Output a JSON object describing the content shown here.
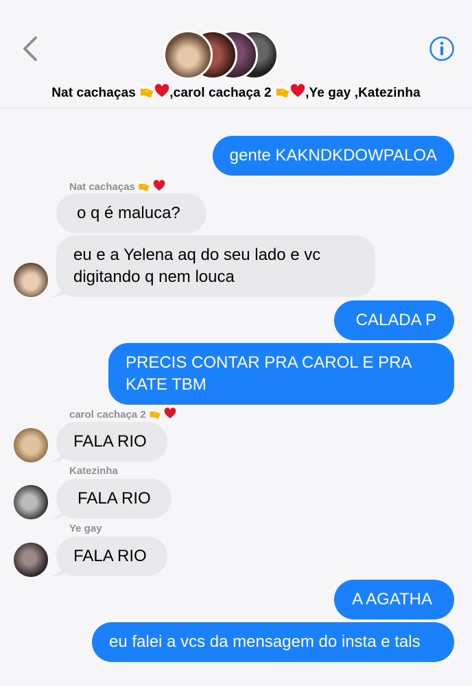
{
  "header": {
    "back_icon": "chevron-left-icon",
    "info_icon": "info-circle-icon",
    "group_name_parts": [
      "Nat cachaças",
      ",carol cachaça 2",
      ",Ye gay",
      ",Katezinha"
    ],
    "accent_color": "#1b81fb"
  },
  "messages": [
    {
      "id": "m1",
      "direction": "outgoing",
      "text": "gente KAKNDKDOWPALOA"
    },
    {
      "id": "m2",
      "direction": "incoming",
      "sender": "Nat cachaças",
      "text": "o q é maluca?"
    },
    {
      "id": "m3",
      "direction": "incoming",
      "sender": "Nat cachaças",
      "text": "eu e a Yelena aq do seu lado e vc digitando q nem louca"
    },
    {
      "id": "m4",
      "direction": "outgoing",
      "text": "CALADA P"
    },
    {
      "id": "m5",
      "direction": "outgoing",
      "text": "PRECIS CONTAR PRA CAROL E PRA KATE TBM"
    },
    {
      "id": "m6",
      "direction": "incoming",
      "sender": "carol cachaça 2",
      "text": "FALA RIO"
    },
    {
      "id": "m7",
      "direction": "incoming",
      "sender": "Katezinha",
      "text": "FALA RIO"
    },
    {
      "id": "m8",
      "direction": "incoming",
      "sender": "Ye gay",
      "text": "FALA RIO"
    },
    {
      "id": "m9",
      "direction": "outgoing",
      "text": "A AGATHA"
    },
    {
      "id": "m10",
      "direction": "outgoing",
      "text": "eu falei a vcs da mensagem do insta e tals"
    }
  ],
  "senders": {
    "nat": "Nat cachaças",
    "carol": "carol cachaça 2",
    "kate": "Katezinha",
    "ye": "Ye gay"
  },
  "colors": {
    "outgoing_bubble": "#1b81fb",
    "incoming_bubble": "#e9e9eb",
    "sender_label": "#8e8e93",
    "background": "#f6f6f8"
  }
}
